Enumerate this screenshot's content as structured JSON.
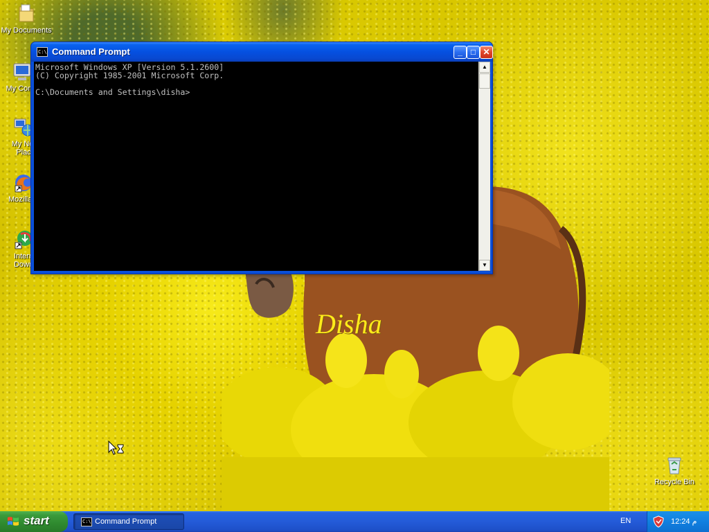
{
  "desktop": {
    "wallpaper_text": "Disha",
    "icons": [
      {
        "label": "My Documents",
        "icon": "my-documents-icon"
      },
      {
        "label": "My Comp",
        "icon": "my-computer-icon"
      },
      {
        "label": "My Net",
        "label2": "Plac",
        "icon": "network-places-icon"
      },
      {
        "label": "Mozilla F",
        "icon": "firefox-icon"
      },
      {
        "label": "Intern",
        "label2": "Down",
        "icon": "download-manager-icon"
      },
      {
        "label": "Recycle Bin",
        "icon": "recycle-bin-icon"
      }
    ]
  },
  "window": {
    "title": "Command Prompt",
    "console_lines": [
      "Microsoft Windows XP [Version 5.1.2600]",
      "(C) Copyright 1985-2001 Microsoft Corp.",
      "",
      "C:\\Documents and Settings\\disha>"
    ],
    "buttons": {
      "minimize": "_",
      "maximize": "□",
      "close": "✕"
    }
  },
  "taskbar": {
    "start_label": "start",
    "task_label": "Command Prompt",
    "language": "EN",
    "clock": "12:24 م"
  },
  "colors": {
    "titlebar": "#0550e0",
    "taskbar": "#245bd8",
    "start_button": "#3a9a3a",
    "console_bg": "#000000",
    "console_fg": "#c0c0c0"
  }
}
